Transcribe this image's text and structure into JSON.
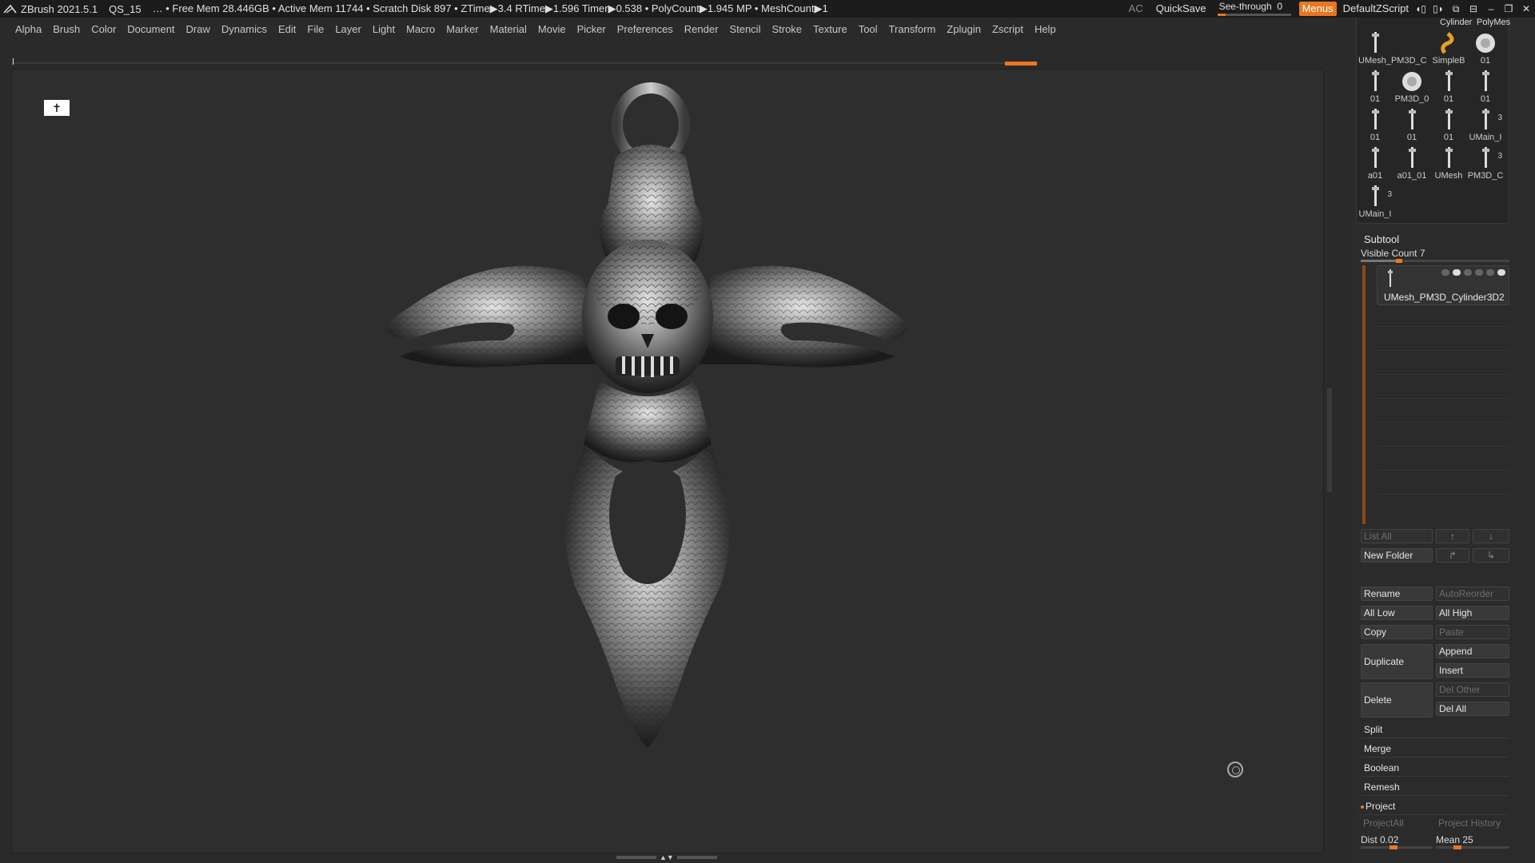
{
  "titlebar": {
    "app": "ZBrush 2021.5.1",
    "file": "QS_15",
    "stats": "… • Free Mem 28.446GB • Active Mem 11744 • Scratch Disk 897 •  ZTime▶3.4 RTime▶1.596 Timer▶0.538 • PolyCount▶1.945 MP  • MeshCount▶1",
    "ac": "AC",
    "quicksave": "QuickSave",
    "seethrough_label": "See-through",
    "seethrough_value": "0",
    "menus": "Menus",
    "script": "DefaultZScript",
    "accent": "#e87722"
  },
  "menubar": [
    "Alpha",
    "Brush",
    "Color",
    "Document",
    "Draw",
    "Dynamics",
    "Edit",
    "File",
    "Layer",
    "Light",
    "Macro",
    "Marker",
    "Material",
    "Movie",
    "Picker",
    "Preferences",
    "Render",
    "Stencil",
    "Stroke",
    "Texture",
    "Tool",
    "Transform",
    "Zplugin",
    "Zscript",
    "Help"
  ],
  "toolgrid": {
    "top_labels": [
      "Cylinder",
      "PolyMes"
    ],
    "items": [
      {
        "label": "UMesh_PM3D_C",
        "count": ""
      },
      {
        "label": "SimpleB",
        "count": ""
      },
      {
        "label": "01",
        "count": ""
      },
      {
        "label": "01",
        "count": ""
      },
      {
        "label": "PM3D_0",
        "count": ""
      },
      {
        "label": "01",
        "count": ""
      },
      {
        "label": "01",
        "count": ""
      },
      {
        "label": "01",
        "count": ""
      },
      {
        "label": "01",
        "count": ""
      },
      {
        "label": "01",
        "count": ""
      },
      {
        "label": "UMain_I",
        "count": "3"
      },
      {
        "label": "a01",
        "count": ""
      },
      {
        "label": "a01_01",
        "count": ""
      },
      {
        "label": "UMesh",
        "count": ""
      },
      {
        "label": "PM3D_C",
        "count": "3"
      },
      {
        "label": "UMain_I",
        "count": "3"
      }
    ]
  },
  "subtool": {
    "title": "Subtool",
    "visible_count_label": "Visible Count 7",
    "visible_count_value": 7,
    "items": [
      {
        "name": "UMesh_PM3D_Cylinder3D2"
      }
    ],
    "buttons": {
      "list_all": "List All",
      "new_folder": "New Folder",
      "rename": "Rename",
      "autoreorder": "AutoReorder",
      "all_low": "All Low",
      "all_high": "All High",
      "copy": "Copy",
      "paste": "Paste",
      "duplicate": "Duplicate",
      "append": "Append",
      "insert": "Insert",
      "delete": "Delete",
      "del_other": "Del Other",
      "del_all": "Del All",
      "split": "Split",
      "merge": "Merge",
      "boolean": "Boolean",
      "remesh": "Remesh",
      "project": "Project",
      "project_all": "ProjectAll",
      "project_history": "Project History",
      "dist_label": "Dist",
      "dist_value": "0.02",
      "mean_label": "Mean",
      "mean_value": "25"
    }
  },
  "viewport": {
    "model": "skull-cross-pendant"
  }
}
